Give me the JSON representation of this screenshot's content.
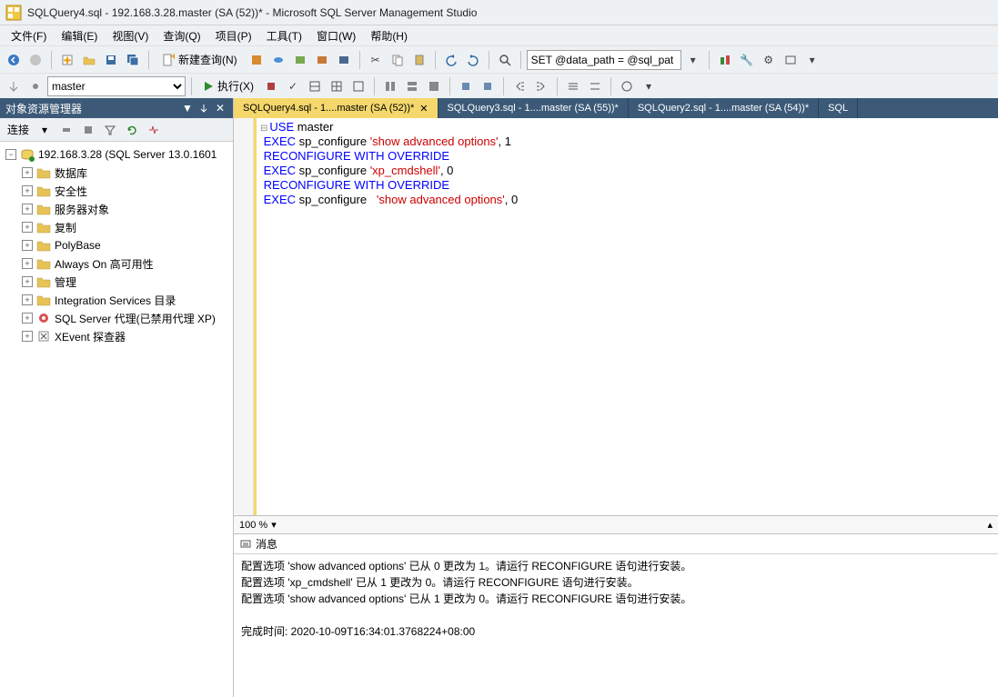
{
  "title": "SQLQuery4.sql - 192.168.3.28.master (SA (52))* - Microsoft SQL Server Management Studio",
  "menu": [
    "文件(F)",
    "编辑(E)",
    "视图(V)",
    "查询(Q)",
    "项目(P)",
    "工具(T)",
    "窗口(W)",
    "帮助(H)"
  ],
  "toolbar1": {
    "new_query": "新建查询(N)",
    "set_var": "SET @data_path = @sql_pat"
  },
  "toolbar2": {
    "db": "master",
    "execute": "执行(X)"
  },
  "sidebar": {
    "title": "对象资源管理器",
    "connect_label": "连接",
    "root": "192.168.3.28 (SQL Server 13.0.1601",
    "nodes": [
      "数据库",
      "安全性",
      "服务器对象",
      "复制",
      "PolyBase",
      "Always On 高可用性",
      "管理",
      "Integration Services 目录",
      "SQL Server 代理(已禁用代理 XP)",
      "XEvent 探查器"
    ]
  },
  "tabs": [
    {
      "label": "SQLQuery4.sql - 1....master (SA (52))*",
      "active": true
    },
    {
      "label": "SQLQuery3.sql - 1....master (SA (55))*",
      "active": false
    },
    {
      "label": "SQLQuery2.sql - 1....master (SA (54))*",
      "active": false
    },
    {
      "label": "SQL",
      "active": false
    }
  ],
  "code": {
    "lines": [
      {
        "t": [
          {
            "c": "kw",
            "v": "USE"
          },
          {
            "c": "",
            "v": " master"
          }
        ]
      },
      {
        "t": [
          {
            "c": "kw",
            "v": "EXEC"
          },
          {
            "c": "",
            "v": " sp_configure "
          },
          {
            "c": "str",
            "v": "'show advanced options'"
          },
          {
            "c": "",
            "v": ", 1"
          }
        ]
      },
      {
        "t": [
          {
            "c": "kw",
            "v": "RECONFIGURE WITH OVERRIDE"
          }
        ]
      },
      {
        "t": [
          {
            "c": "kw",
            "v": "EXEC"
          },
          {
            "c": "",
            "v": " sp_configure "
          },
          {
            "c": "str",
            "v": "'xp_cmdshell'"
          },
          {
            "c": "",
            "v": ", 0"
          }
        ]
      },
      {
        "t": [
          {
            "c": "kw",
            "v": "RECONFIGURE WITH OVERRIDE"
          }
        ]
      },
      {
        "t": [
          {
            "c": "kw",
            "v": "EXEC"
          },
          {
            "c": "",
            "v": " sp_configure   "
          },
          {
            "c": "str",
            "v": "'show advanced options'"
          },
          {
            "c": "",
            "v": ", 0"
          }
        ]
      }
    ]
  },
  "zoom": "100 %",
  "messages": {
    "tab": "消息",
    "lines": [
      "配置选项 'show advanced options' 已从 0 更改为 1。请运行 RECONFIGURE 语句进行安装。",
      "配置选项 'xp_cmdshell' 已从 1 更改为 0。请运行 RECONFIGURE 语句进行安装。",
      "配置选项 'show advanced options' 已从 1 更改为 0。请运行 RECONFIGURE 语句进行安装。",
      "",
      "完成时间: 2020-10-09T16:34:01.3768224+08:00"
    ]
  }
}
